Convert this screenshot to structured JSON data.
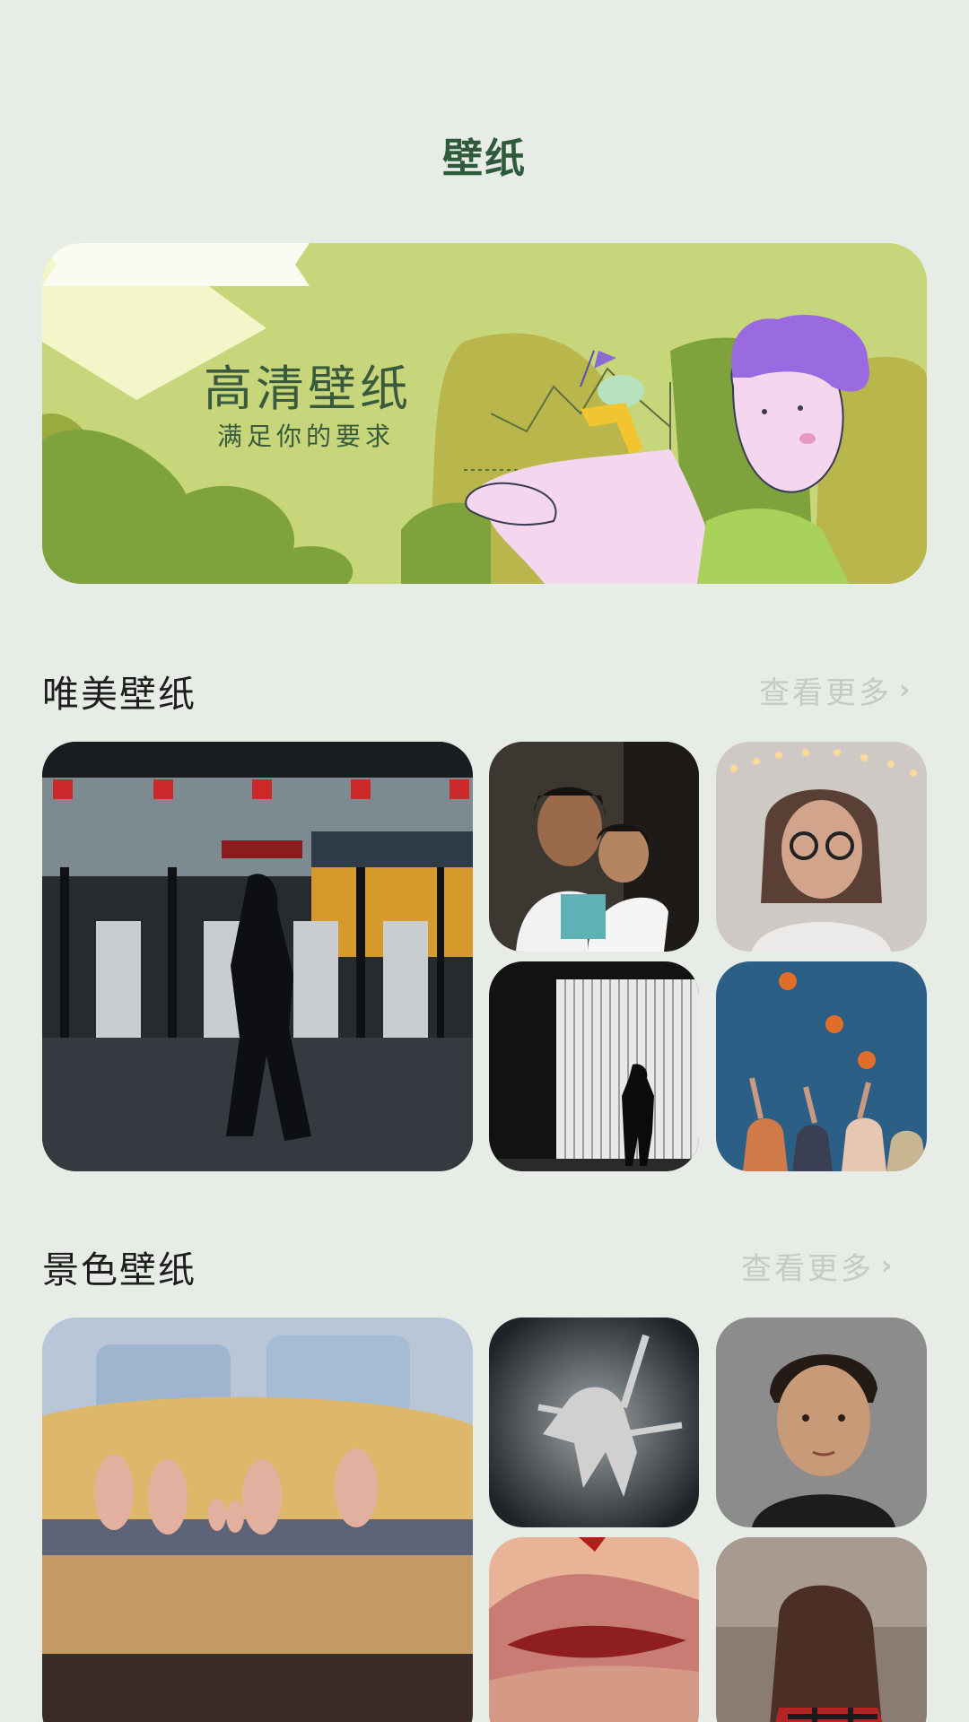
{
  "header": {
    "title": "壁纸"
  },
  "banner": {
    "title": "高清壁纸",
    "subtitle": "满足你的要求"
  },
  "sections": [
    {
      "title": "唯美壁纸",
      "more_label": "查看更多",
      "images": [
        "train-station-gates-photo",
        "mother-and-child-photo",
        "woman-with-glasses-lights-photo",
        "man-silhouette-light-wall-photo",
        "friends-throwing-oranges-photo"
      ]
    },
    {
      "title": "景色壁纸",
      "more_label": "查看更多",
      "images": [
        "feet-under-blanket-photo",
        "dancers-acrobatic-photo",
        "young-man-portrait-photo",
        "lips-text-art-photo",
        "girl-back-hair-photo"
      ]
    }
  ],
  "colors": {
    "background": "#e8ece6",
    "title": "#2f5b3d",
    "banner_bg": "#c7d67a",
    "more_text": "#c6cac4"
  }
}
